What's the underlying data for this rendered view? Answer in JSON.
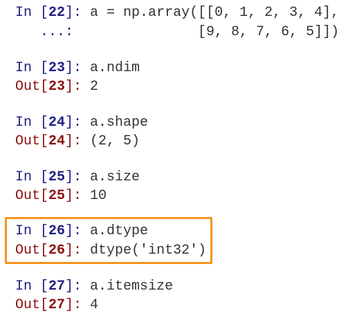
{
  "cells": [
    {
      "n": "22",
      "input": [
        "a = np.array([[0, 1, 2, 3, 4],",
        "              [9, 8, 7, 6, 5]])"
      ],
      "cont_prompt": "   ...: ",
      "output": null
    },
    {
      "n": "23",
      "input": [
        "a.ndim"
      ],
      "output": "2"
    },
    {
      "n": "24",
      "input": [
        "a.shape"
      ],
      "output": "(2, 5)"
    },
    {
      "n": "25",
      "input": [
        "a.size"
      ],
      "output": "10"
    },
    {
      "n": "26",
      "input": [
        "a.dtype"
      ],
      "output": "dtype('int32')",
      "highlighted": true
    },
    {
      "n": "27",
      "input": [
        "a.itemsize"
      ],
      "output": "4"
    }
  ],
  "prompts": {
    "in_prefix": "In [",
    "out_prefix": "Out[",
    "suffix": "]: "
  },
  "colors": {
    "in_prompt": "#1e1e82",
    "out_prompt": "#8b1010",
    "highlight": "#f7941d"
  }
}
